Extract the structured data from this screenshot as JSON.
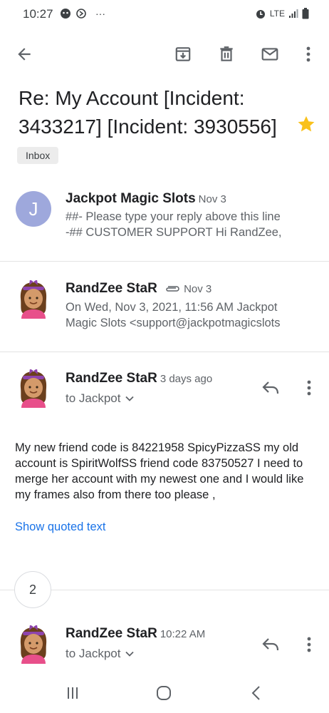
{
  "status_bar": {
    "time": "10:27",
    "more": "···",
    "network": "LTE",
    "icons": [
      "alarm-icon",
      "signal-icon",
      "battery-icon"
    ]
  },
  "toolbar": {
    "icons": [
      "back-arrow-icon",
      "archive-icon",
      "delete-icon",
      "mark-unread-icon",
      "more-vert-icon"
    ]
  },
  "email": {
    "subject": "Re: My Account [Incident: 3433217] [Incident: 3930556]",
    "starred": true,
    "label": "Inbox"
  },
  "messages": [
    {
      "sender": "Jackpot Magic Slots",
      "avatar_letter": "J",
      "date": "Nov 3",
      "snippet_line1": "##- Please type your reply above this line",
      "snippet_line2": "-## CUSTOMER SUPPORT Hi RandZee,"
    },
    {
      "sender": "RandZee StaR",
      "date": "Nov 3",
      "has_attachment_icon": true,
      "snippet_line1": "On Wed, Nov 3, 2021, 11:56 AM Jackpot",
      "snippet_line2": "Magic Slots <support@jackpotmagicslots"
    },
    {
      "sender": "RandZee StaR",
      "date": "3 days ago",
      "to": "to Jackpot",
      "body": "My new friend code is 84221958 SpicyPizzaSS my old account is SpiritWolfSS friend code 83750527 I need to merge her account with my newest one and I would like my frames also from there too please ,",
      "show_quoted": "Show quoted text"
    },
    {
      "sender": "RandZee StaR",
      "date": "10:22 AM",
      "to": "to Jackpot"
    }
  ],
  "collapsed_count": "2",
  "nav_bar": {
    "icons": [
      "recent-apps-icon",
      "home-icon",
      "back-icon"
    ]
  },
  "colors": {
    "star": "#f9c11b",
    "link": "#1a73e8",
    "avatar_j": "#9ea8dc"
  }
}
